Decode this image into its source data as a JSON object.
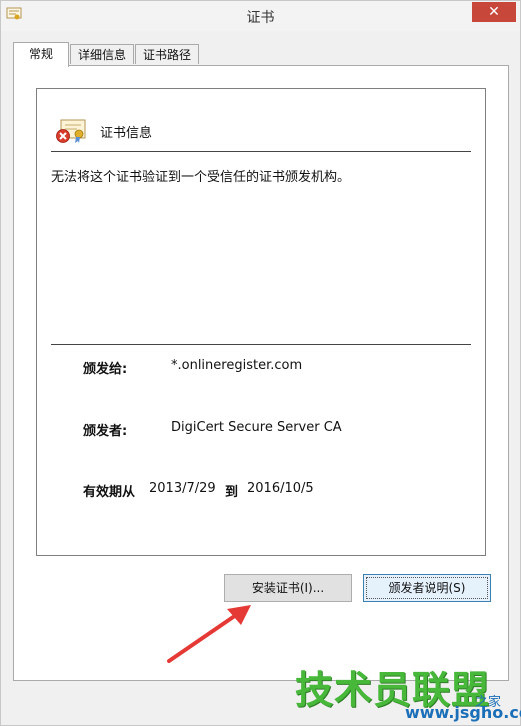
{
  "window": {
    "title": "证书",
    "close_glyph": "✕"
  },
  "tabs": [
    {
      "label": "常规",
      "active": true
    },
    {
      "label": "详细信息",
      "active": false
    },
    {
      "label": "证书路径",
      "active": false
    }
  ],
  "certificate": {
    "section_title": "证书信息",
    "warning": "无法将这个证书验证到一个受信任的证书颁发机构。",
    "issued_to_label": "颁发给:",
    "issued_to_value": "*.onlineregister.com",
    "issued_by_label": "颁发者:",
    "issued_by_value": "DigiCert Secure Server CA",
    "validity_from_label": "有效期从",
    "validity_from": "2013/7/29",
    "validity_to_label": "到",
    "validity_to": "2016/10/5"
  },
  "buttons": {
    "install": "安装证书(I)...",
    "issuer_statement": "颁发者说明(S)"
  },
  "watermark": {
    "main": "技术员联盟",
    "url": "www.jsgho.com",
    "suffix": "之家"
  },
  "colors": {
    "close_button": "#c7483b",
    "arrow": "#e53935",
    "watermark_green": "#47b83a",
    "watermark_blue": "#1b6fb8"
  },
  "icons": {
    "title": "certificate-icon",
    "cert_error": "certificate-error-icon",
    "annotation": "red-arrow"
  }
}
